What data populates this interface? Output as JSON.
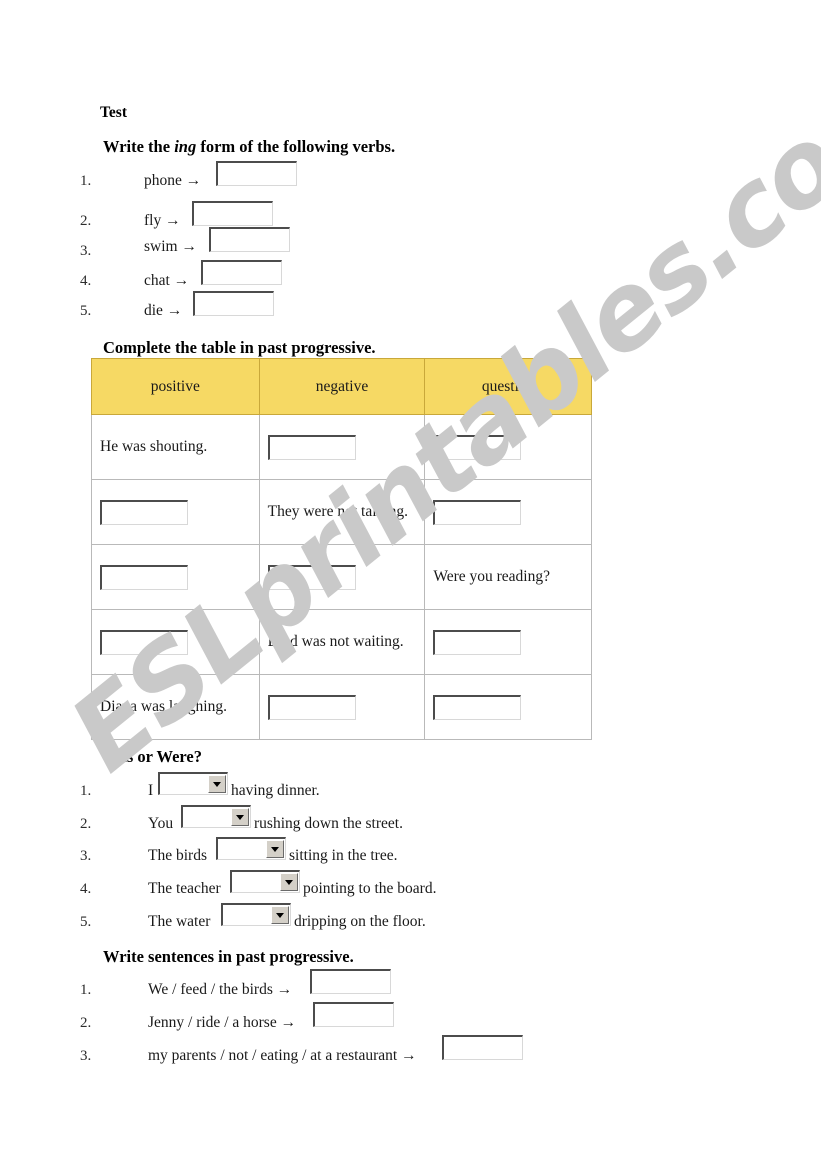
{
  "document": {
    "title": "Test",
    "watermark": "ESLprintables.com",
    "watermark_color": "#c9c9c9"
  },
  "section_ing": {
    "heading_before": "Write the ",
    "heading_italic": "ing",
    "heading_after": " form of the following verbs.",
    "arrow": "→",
    "items": [
      {
        "number": "1.",
        "verb": "phone",
        "answer": ""
      },
      {
        "number": "2.",
        "verb": "fly",
        "answer": ""
      },
      {
        "number": "3.",
        "verb": "swim",
        "answer": ""
      },
      {
        "number": "4.",
        "verb": "chat",
        "answer": ""
      },
      {
        "number": "5.",
        "verb": "die",
        "answer": ""
      }
    ]
  },
  "section_table": {
    "heading": "Complete the table in past progressive.",
    "header_color": "#f6d964",
    "columns": [
      "positive",
      "negative",
      "question"
    ],
    "rows": [
      {
        "positive": "He was shouting.",
        "negative": "",
        "question": ""
      },
      {
        "positive": "",
        "negative": "They were not talking.",
        "question": ""
      },
      {
        "positive": "",
        "negative": "",
        "question": "Were you reading?"
      },
      {
        "positive": "",
        "negative": "Brad was not waiting.",
        "question": ""
      },
      {
        "positive": "Diana was laughing.",
        "negative": "",
        "question": ""
      }
    ]
  },
  "section_wasorwere": {
    "heading": "Was or Were?",
    "select_value": "",
    "items": [
      {
        "number": "1.",
        "before": "I",
        "after": "having dinner."
      },
      {
        "number": "2.",
        "before": "You",
        "after": "rushing down the street."
      },
      {
        "number": "3.",
        "before": "The birds",
        "after": "sitting in the tree."
      },
      {
        "number": "4.",
        "before": "The teacher",
        "after": "pointing to the board."
      },
      {
        "number": "5.",
        "before": "The water",
        "after": "dripping on the floor."
      }
    ]
  },
  "section_sentences": {
    "heading": "Write sentences in past progressive.",
    "arrow": "→",
    "items": [
      {
        "number": "1.",
        "prompt": "We / feed / the birds",
        "answer": ""
      },
      {
        "number": "2.",
        "prompt": "Jenny / ride / a horse",
        "answer": ""
      },
      {
        "number": "3.",
        "prompt": "my parents / not / eating / at a restaurant",
        "answer": ""
      }
    ]
  }
}
